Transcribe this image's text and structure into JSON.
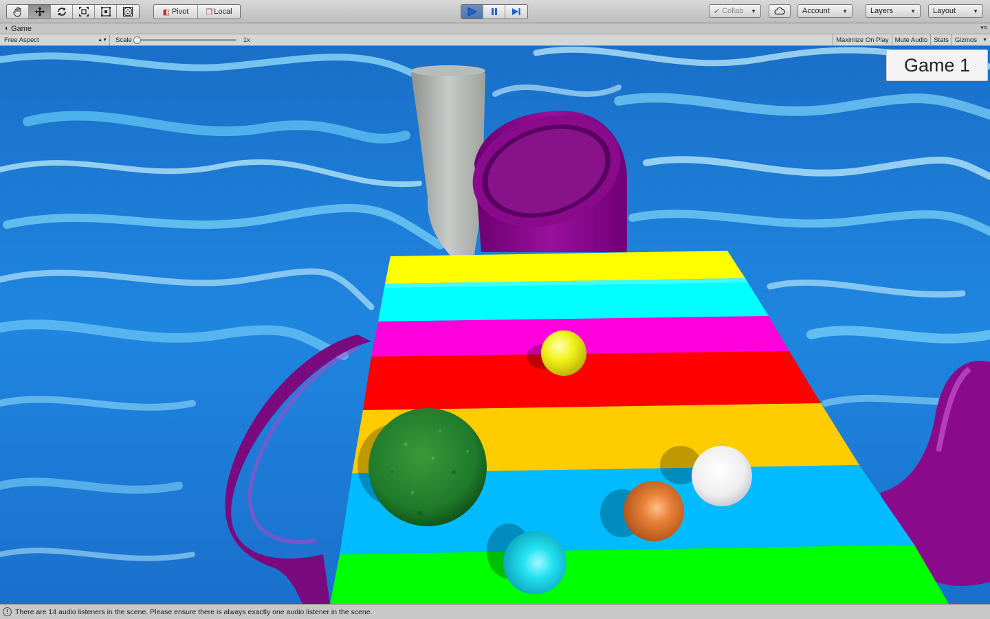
{
  "toolbar": {
    "tools": [
      {
        "name": "hand-tool",
        "icon": "hand-icon",
        "active": false
      },
      {
        "name": "move-tool",
        "icon": "move-icon",
        "active": true
      },
      {
        "name": "rotate-tool",
        "icon": "rotate-icon",
        "active": false
      },
      {
        "name": "scale-tool",
        "icon": "scale-icon",
        "active": false
      },
      {
        "name": "rect-tool",
        "icon": "rect-icon",
        "active": false
      },
      {
        "name": "transform-tool",
        "icon": "transform-icon",
        "active": false
      }
    ],
    "pivot_label": "Pivot",
    "local_label": "Local",
    "play_state": "playing",
    "collab_label": "Collab",
    "account_label": "Account",
    "layers_label": "Layers",
    "layout_label": "Layout"
  },
  "panel": {
    "tab_title": "Game"
  },
  "game_bar": {
    "aspect": "Free Aspect",
    "scale_label": "Scale",
    "scale_value": "1x",
    "scale_fraction": 0,
    "maximize_label": "Maximize On Play",
    "mute_label": "Mute Audio",
    "stats_label": "Stats",
    "gizmos_label": "Gizmos"
  },
  "viewport": {
    "overlay_label": "Game 1",
    "colors": {
      "water": "#1f7fd6",
      "pipe_purple": "#8a0a8c",
      "pipe_grey": "#a8aca8",
      "stripes": [
        "#ffff00",
        "#00ffff",
        "#ff00dd",
        "#ff0000",
        "#ffcc00",
        "#00bbff",
        "#00ff00"
      ],
      "balls": {
        "yellow": "#f2f21a",
        "green": "#1f7a2a",
        "white": "#f2f2f2",
        "orange": "#e07a22",
        "cyan": "#22e0f0"
      }
    }
  },
  "status": {
    "message": "There are 14 audio listeners in the scene. Please ensure there is always exactly one audio listener in the scene."
  }
}
